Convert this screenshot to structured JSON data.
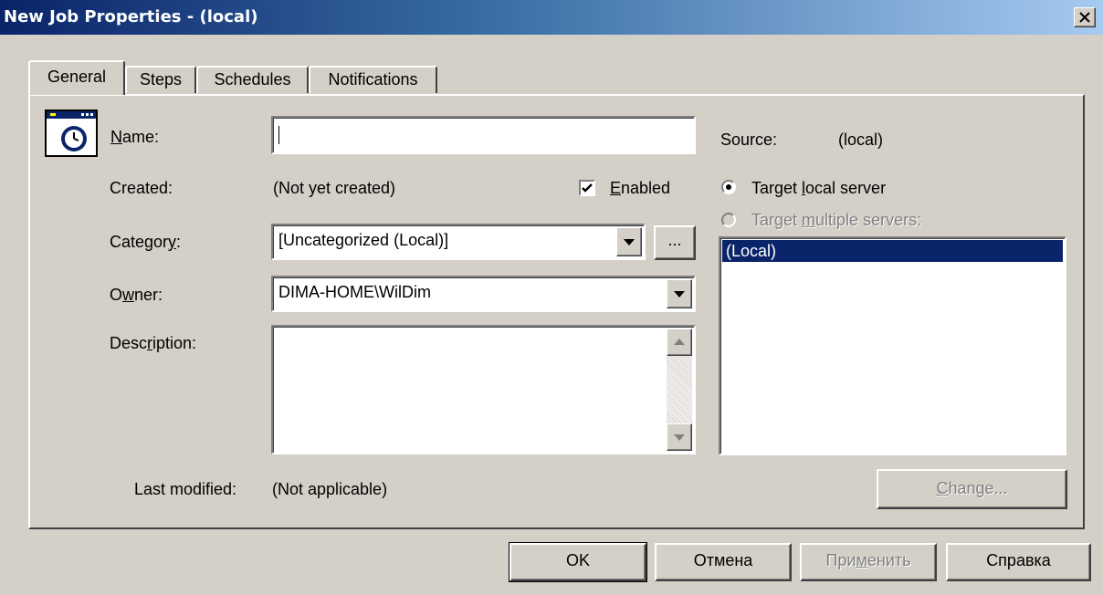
{
  "window": {
    "title": "New Job Properties - (local)"
  },
  "tabs": [
    {
      "label": "General",
      "active": true
    },
    {
      "label": "Steps",
      "active": false
    },
    {
      "label": "Schedules",
      "active": false
    },
    {
      "label": "Notifications",
      "active": false
    }
  ],
  "general": {
    "name_label_pre": "",
    "name_label_ul": "N",
    "name_label_post": "ame:",
    "name_value": "",
    "source_label": "Source:",
    "source_value": "(local)",
    "created_label": "Created:",
    "created_value": "(Not yet created)",
    "enabled_label_ul": "E",
    "enabled_label_post": "nabled",
    "enabled_checked": true,
    "category_label_pre": "Categor",
    "category_label_ul": "y",
    "category_label_post": ":",
    "category_value": "[Uncategorized (Local)]",
    "category_browse_label": "...",
    "owner_label_pre": "O",
    "owner_label_ul": "w",
    "owner_label_post": "ner:",
    "owner_value": "DIMA-HOME\\WilDim",
    "description_label_pre": "Desc",
    "description_label_ul": "r",
    "description_label_post": "iption:",
    "description_value": "",
    "last_modified_label": "Last modified:",
    "last_modified_value": "(Not applicable)"
  },
  "target": {
    "local_pre": "Target ",
    "local_ul": "l",
    "local_post": "ocal server",
    "local_selected": true,
    "multiple_pre": "Target ",
    "multiple_ul": "m",
    "multiple_post": "ultiple servers:",
    "multiple_selected": false,
    "servers": [
      "(Local)"
    ],
    "change_ul": "C",
    "change_post": "hange..."
  },
  "footer": {
    "ok": "OK",
    "cancel": "Отмена",
    "apply_pre": "При",
    "apply_ul": "м",
    "apply_post": "енить",
    "help": "Справка"
  },
  "colors": {
    "face": "#d4d0c8",
    "title_start": "#0a246a",
    "title_end": "#a6caf0",
    "selection": "#0a246a"
  },
  "icons": {
    "job": "job-clock-icon",
    "close": "close-icon"
  }
}
